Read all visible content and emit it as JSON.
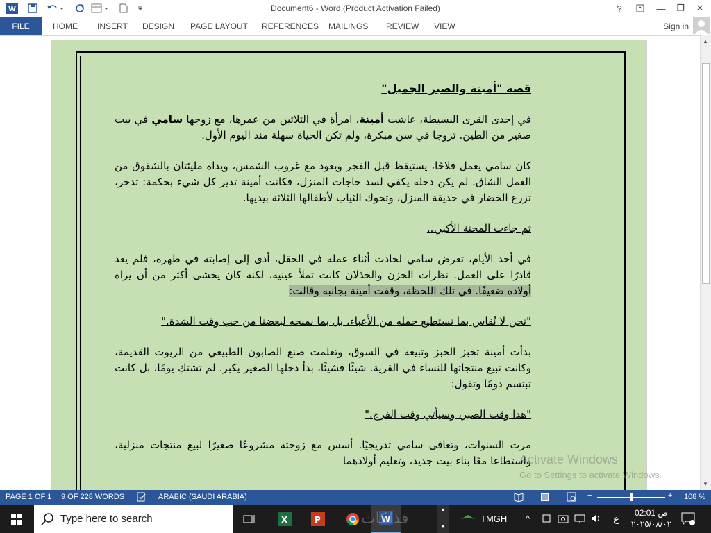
{
  "window": {
    "title": "Document6 - Word (Product Activation Failed)",
    "help": "?",
    "minimize": "—",
    "restore": "❐",
    "close": "✕"
  },
  "ribbon": {
    "file": "FILE",
    "tabs": [
      "HOME",
      "INSERT",
      "DESIGN",
      "PAGE LAYOUT",
      "REFERENCES",
      "MAILINGS",
      "REVIEW",
      "VIEW"
    ],
    "sign_in": "Sign in"
  },
  "document": {
    "title": "قصة \"أمينة والصبر الجميل\"",
    "p1_a": "في إحدى القرى البسيطة، عاشت ",
    "p1_name1": "أمينة",
    "p1_b": "، امرأة في الثلاثين من عمرها، مع زوجها ",
    "p1_name2": "سامي",
    "p1_c": " في بيت صغير من الطين. تزوجا في سن مبكرة، ولم تكن الحياة سهلة منذ اليوم الأول.",
    "p2": "كان سامي يعمل فلاحًا، يستيقظ قبل الفجر ويعود مع غروب الشمس، ويداه مليئتان بالشقوق من العمل الشاق. لم يكن دخله يكفي لسد حاجات المنزل، فكانت أمينة تدير كل شيء بحكمة: تدخر، تزرع الخضار في حديقة المنزل، وتحوك الثياب لأطفالها الثلاثة بيديها.",
    "p3": "ثم جاءت المحنة الأكبر...",
    "p4_a": "في أحد الأيام، تعرض سامي لحادث أثناء عمله في الحقل، أدى إلى إصابته في ظهره، فلم يعد قادرًا على العمل. نظرات الحزن والخذلان كانت تملأ عينيه، لكنه كان يخشى أكثر من أن يراه ",
    "p4_hl": "أولاده ضعيفًا. في تلك اللحظة، وقفت أمينة بجانبه وقالت:",
    "p5": "\"نحن لا نُقاس بما نستطيع حمله من الأعباء، بل بما نمنحه لبعضنا من حب وقت الشدة.\"",
    "p6": "بدأت أمينة تخبز الخبز وتبيعه في السوق، وتعلمت صنع الصابون الطبيعي من الزيوت القديمة، وكانت تبيع منتجاتها للنساء في القرية. شيئًا فشيئًا، بدأ دخلها الصغير يكبر. لم تشتكِ يومًا، بل كانت تبتسم دومًا وتقول:",
    "p7": "\"هذا وقت الصبر، وسيأتي وقت الفرج.\"",
    "p8": "مرت السنوات، وتعافى سامي تدريجيًا. أسس مع زوجته مشروعًا صغيرًا لبيع منتجات منزلية، واستطاعا معًا بناء بيت جديد، وتعليم أولادهما"
  },
  "status": {
    "page": "PAGE 1 OF 1",
    "words": "9 OF 228 WORDS",
    "language": "ARABIC (SAUDI ARABIA)",
    "zoom": "108 %",
    "zoom_minus": "−",
    "zoom_plus": "+"
  },
  "zoom_level": 108,
  "watermark": {
    "line1": "Activate Windows",
    "line2": "Go to Settings to activate Windows."
  },
  "taskbar": {
    "search_placeholder": "Type here to search",
    "tray_label": "TMGH",
    "lang": "ع",
    "time": "02:01 ص",
    "date": "٢٠٢٥/٠٨/٠٢",
    "caret": "^",
    "site_watermark": "فذلكات"
  },
  "colors": {
    "word_blue": "#2b579a",
    "page_green": "#c6e0b4",
    "taskbar": "#1c1c1c"
  }
}
